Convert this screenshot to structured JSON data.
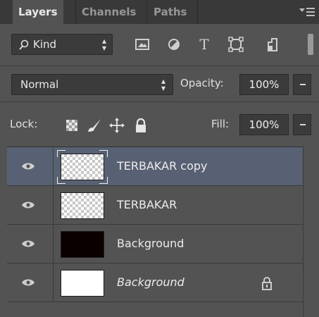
{
  "tabs": [
    {
      "label": "Layers",
      "active": true
    },
    {
      "label": "Channels",
      "active": false
    },
    {
      "label": "Paths",
      "active": false
    }
  ],
  "filter": {
    "kind_label": "Kind",
    "icons": [
      "image-filter-icon",
      "adjustment-filter-icon",
      "type-filter-icon",
      "shape-filter-icon",
      "smart-object-filter-icon"
    ],
    "type_glyph": "T"
  },
  "blend": {
    "mode": "Normal",
    "opacity_label": "Opacity:",
    "opacity_value": "100%"
  },
  "lock": {
    "label": "Lock:",
    "fill_label": "Fill:",
    "fill_value": "100%"
  },
  "layers": [
    {
      "name": "TERBAKAR copy",
      "thumb": "transparent",
      "selected": true,
      "italic": false,
      "locked": false
    },
    {
      "name": "TERBAKAR",
      "thumb": "transparent",
      "selected": false,
      "italic": false,
      "locked": false
    },
    {
      "name": "Background",
      "thumb": "black",
      "selected": false,
      "italic": false,
      "locked": false
    },
    {
      "name": "Background",
      "thumb": "white",
      "selected": false,
      "italic": true,
      "locked": true
    }
  ],
  "colors": {
    "panel_bg": "#535353",
    "tab_bar_bg": "#393939",
    "selected_row": "#586173"
  }
}
